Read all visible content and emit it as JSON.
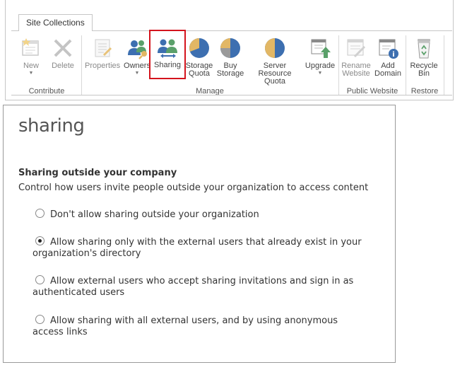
{
  "ribbon": {
    "tab_label": "Site Collections",
    "commands": {
      "new": {
        "line1": "New",
        "line2": ""
      },
      "delete": {
        "line1": "Delete",
        "line2": ""
      },
      "properties": {
        "line1": "Properties",
        "line2": ""
      },
      "owners": {
        "line1": "Owners",
        "line2": ""
      },
      "sharing": {
        "line1": "Sharing",
        "line2": ""
      },
      "storage_quota": {
        "line1": "Storage",
        "line2": "Quota"
      },
      "buy_storage": {
        "line1": "Buy",
        "line2": "Storage"
      },
      "server_resource_quota": {
        "line1": "Server Resource",
        "line2": "Quota"
      },
      "upgrade": {
        "line1": "Upgrade",
        "line2": ""
      },
      "rename_website": {
        "line1": "Rename",
        "line2": "Website"
      },
      "add_domain": {
        "line1": "Add",
        "line2": "Domain"
      },
      "recycle_bin": {
        "line1": "Recycle",
        "line2": "Bin"
      }
    },
    "groups": {
      "contribute": "Contribute",
      "manage": "Manage",
      "public_website": "Public Website",
      "restore": "Restore"
    },
    "colors": {
      "selected_outline": "#d4141d",
      "pie_blue": "#3d6fb0",
      "pie_tan": "#e2b765"
    }
  },
  "panel": {
    "title": "sharing",
    "section_heading": "Sharing outside your company",
    "section_description": "Control how users invite people outside your organization to access content",
    "options": [
      {
        "line1": "Don't allow sharing outside your organization",
        "line2": "",
        "checked": false
      },
      {
        "line1": "Allow sharing only with the external users that already exist in your",
        "line2": "organization's directory",
        "checked": true
      },
      {
        "line1": "Allow external users who accept sharing invitations and sign in as",
        "line2": "authenticated users",
        "checked": false
      },
      {
        "line1": "Allow sharing with all external users, and by using anonymous",
        "line2": "access links",
        "checked": false
      }
    ]
  }
}
